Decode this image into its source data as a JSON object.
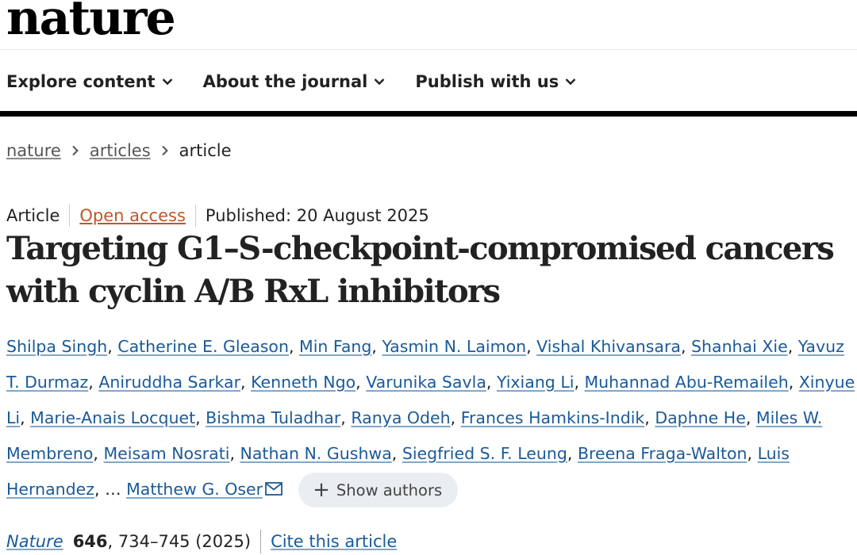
{
  "header": {
    "logo": "nature"
  },
  "nav": {
    "items": [
      {
        "label": "Explore content"
      },
      {
        "label": "About the journal"
      },
      {
        "label": "Publish with us"
      }
    ]
  },
  "breadcrumb": {
    "items": [
      "nature",
      "articles"
    ],
    "current": "article"
  },
  "article": {
    "type": "Article",
    "access": "Open access",
    "published": "Published: 20 August 2025",
    "title": "Targeting G1–S-checkpoint-compromised cancers with cyclin A/B RxL inhibitors",
    "authors": [
      "Shilpa Singh",
      "Catherine E. Gleason",
      "Min Fang",
      "Yasmin N. Laimon",
      "Vishal Khivansara",
      "Shanhai Xie",
      "Yavuz T. Durmaz",
      "Aniruddha Sarkar",
      "Kenneth Ngo",
      "Varunika Savla",
      "Yixiang Li",
      "Muhannad Abu-Remaileh",
      "Xinyue Li",
      "Marie-Anais Locquet",
      "Bishma Tuladhar",
      "Ranya Odeh",
      "Frances Hamkins-Indik",
      "Daphne He",
      "Miles W. Membreno",
      "Meisam Nosrati",
      "Nathan N. Gushwa",
      "Siegfried S. F. Leung",
      "Breena Fraga-Walton",
      "Luis Hernandez"
    ],
    "ellipsis": "…",
    "last_author": "Matthew G. Oser",
    "show_authors_label": "Show authors"
  },
  "citation": {
    "journal": "Nature",
    "volume": "646",
    "pages_year": ", 734–745 (2025)",
    "cite_label": "Cite this article"
  },
  "colors": {
    "link": "#1a5a99",
    "open_access": "#c0552b",
    "nav_bar": "#000000"
  },
  "icons": {
    "nav_dropdown": "chevron-down-icon",
    "breadcrumb_separator": "chevron-right-icon",
    "corresponding_author": "mail-icon",
    "show_authors": "plus-icon"
  }
}
